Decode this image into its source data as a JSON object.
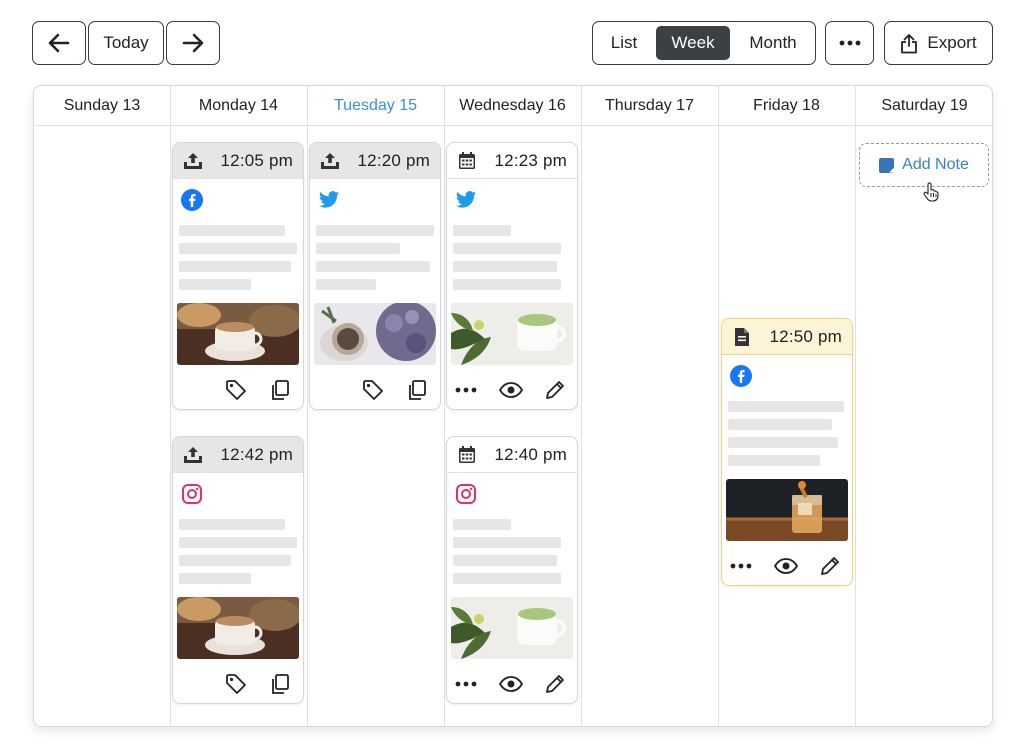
{
  "toolbar": {
    "prev_icon": "arrow-left-icon",
    "today_label": "Today",
    "next_icon": "arrow-right-icon",
    "view_options": [
      {
        "label": "List",
        "active": false
      },
      {
        "label": "Week",
        "active": true
      },
      {
        "label": "Month",
        "active": false
      }
    ],
    "more_label": "•••",
    "export_label": "Export",
    "export_icon": "share-upload-icon"
  },
  "days": [
    {
      "label": "Sunday 13",
      "today": false
    },
    {
      "label": "Monday 14",
      "today": false
    },
    {
      "label": "Tuesday 15",
      "today": true
    },
    {
      "label": "Wednesday 16",
      "today": false
    },
    {
      "label": "Thursday 17",
      "today": false
    },
    {
      "label": "Friday 18",
      "today": false
    },
    {
      "label": "Saturday 19",
      "today": false
    }
  ],
  "posts": [
    {
      "id": "mon-1",
      "day": "Monday 14",
      "time": "12:05 pm",
      "status_icon": "upload-tray-icon",
      "network": "facebook-icon",
      "image": "coffee-croissant-photo",
      "actions": [
        "tag-icon",
        "copy-icon"
      ],
      "header_style": "grey"
    },
    {
      "id": "tue-1",
      "day": "Tuesday 15",
      "time": "12:20 pm",
      "status_icon": "upload-tray-icon",
      "network": "twitter-icon",
      "image": "lavender-cup-photo",
      "actions": [
        "tag-icon",
        "copy-icon"
      ],
      "header_style": "grey"
    },
    {
      "id": "wed-1",
      "day": "Wednesday 16",
      "time": "12:23 pm",
      "status_icon": "calendar-icon",
      "network": "twitter-icon",
      "image": "matcha-latte-photo",
      "actions": [
        "more-dots-icon",
        "eye-icon",
        "pencil-icon"
      ],
      "header_style": "white"
    },
    {
      "id": "mon-2",
      "day": "Monday 14",
      "time": "12:42 pm",
      "status_icon": "upload-tray-icon",
      "network": "instagram-icon",
      "image": "coffee-croissant-photo",
      "actions": [
        "tag-icon",
        "copy-icon"
      ],
      "header_style": "grey"
    },
    {
      "id": "wed-2",
      "day": "Wednesday 16",
      "time": "12:40 pm",
      "status_icon": "calendar-icon",
      "network": "instagram-icon",
      "image": "matcha-latte-photo",
      "actions": [
        "more-dots-icon",
        "eye-icon",
        "pencil-icon"
      ],
      "header_style": "white"
    },
    {
      "id": "fri-1",
      "day": "Friday 18",
      "time": "12:50 pm",
      "status_icon": "document-icon",
      "network": "facebook-icon",
      "image": "cocktail-glass-photo",
      "actions": [
        "more-dots-icon",
        "eye-icon",
        "pencil-icon"
      ],
      "header_style": "yellow"
    }
  ],
  "add_note": {
    "label": "Add Note",
    "icon": "sticky-note-icon"
  },
  "colors": {
    "accent_blue": "#3b8fd6",
    "facebook": "#1877f2",
    "twitter": "#1d9bf0",
    "instagram": "#e1306c",
    "draft_border": "#f2d27a",
    "active_segment": "#3a4043"
  }
}
